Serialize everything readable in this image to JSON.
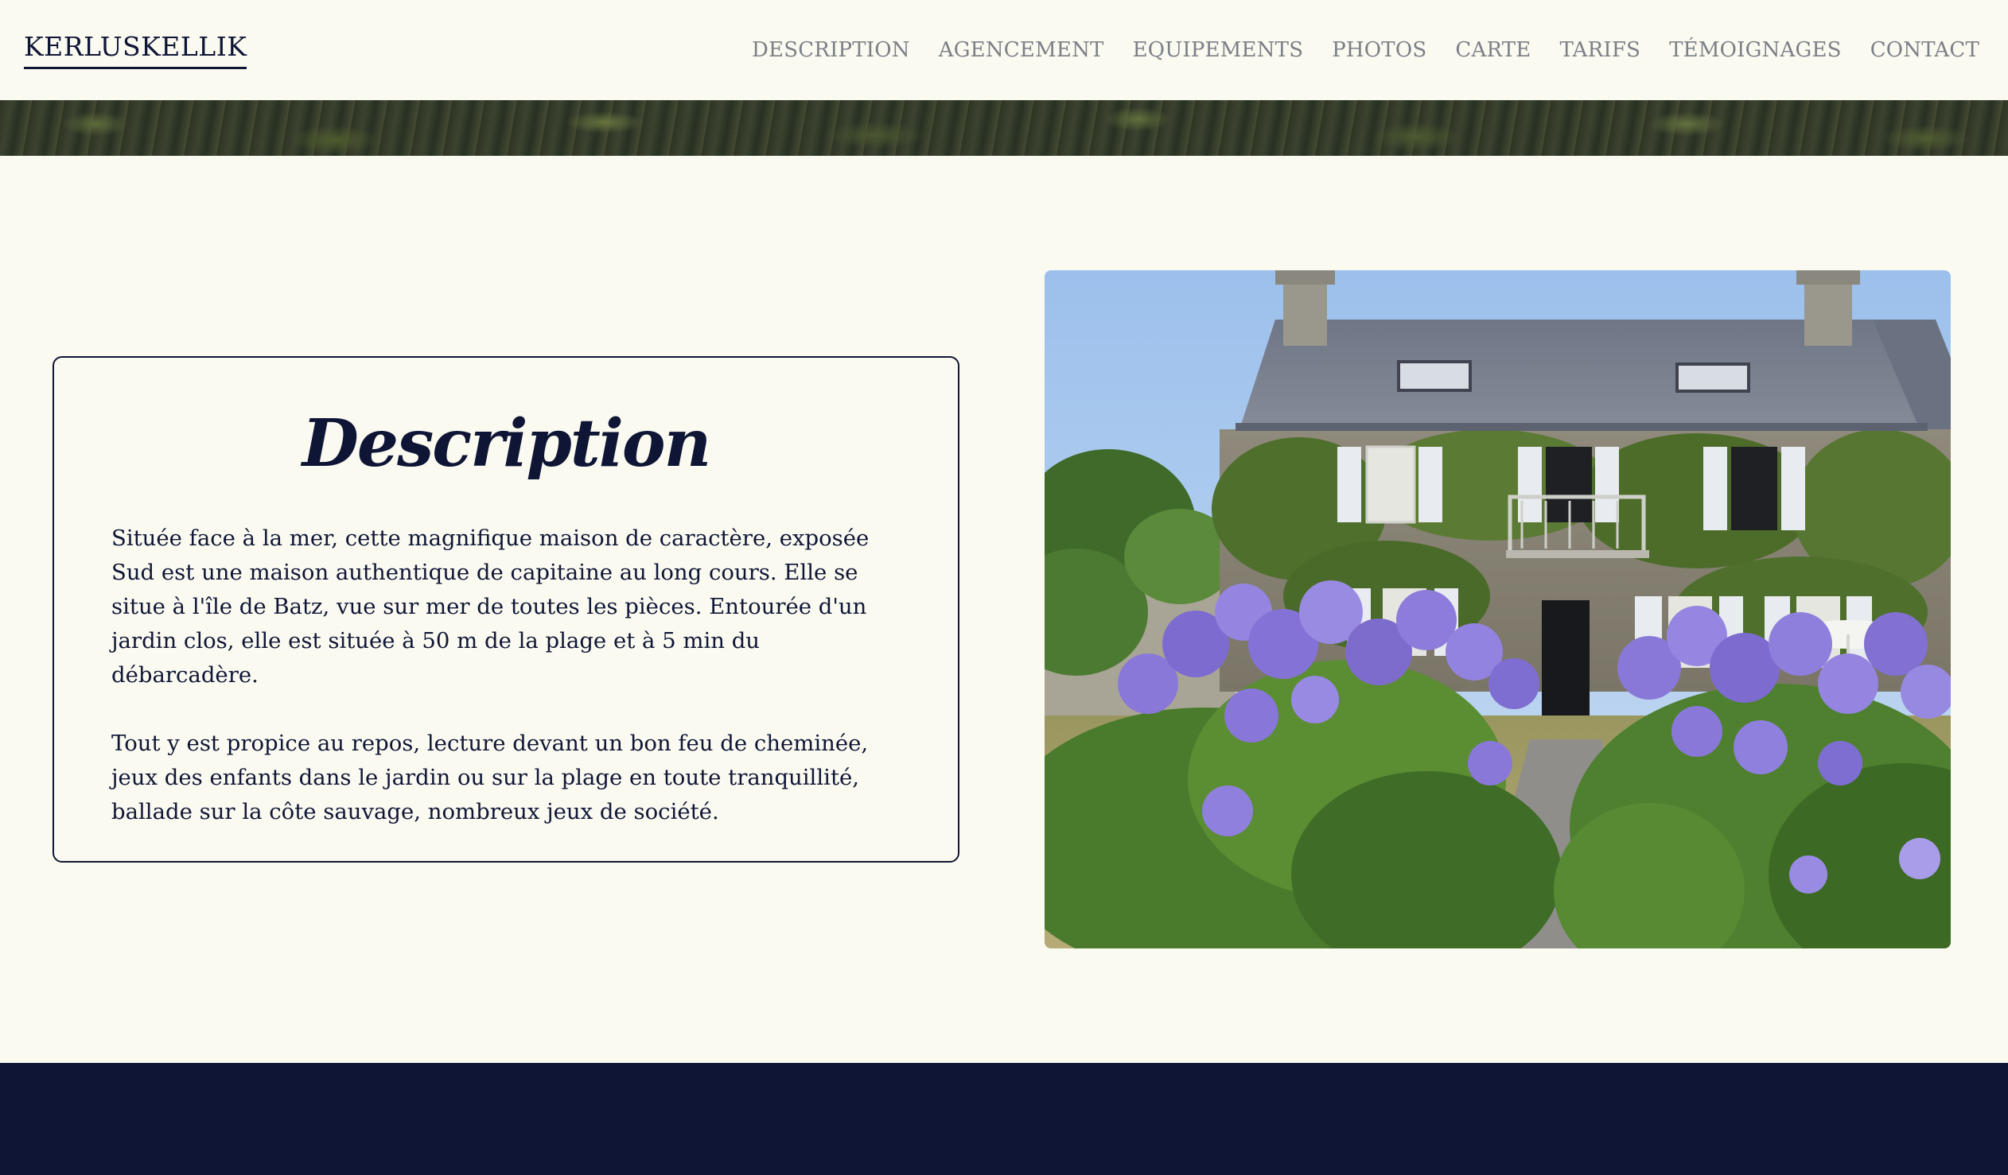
{
  "header": {
    "logo": "KERLUSKELLIK",
    "nav": [
      "DESCRIPTION",
      "AGENCEMENT",
      "EQUIPEMENTS",
      "PHOTOS",
      "CARTE",
      "TARIFS",
      "TÉMOIGNAGES",
      "CONTACT"
    ]
  },
  "description": {
    "title": "Description",
    "paragraph_1": "Située face à la mer, cette magnifique maison de caractère, exposée Sud est une maison authentique de capitaine au long cours. Elle se situe à l'île de Batz, vue sur mer de toutes les pièces. Entourée d'un jardin clos, elle est située à 50 m de la plage et à 5 min du débarcadère.",
    "paragraph_2": "Tout y est propice au repos, lecture devant un bon feu de cheminée, jeux des enfants dans le jardin ou sur la plage en toute tranquillité, ballade sur la côte sauvage, nombreux jeux de société."
  },
  "colors": {
    "background": "#fafaf1",
    "navy": "#0f1535",
    "nav_text": "#7c7f86"
  }
}
